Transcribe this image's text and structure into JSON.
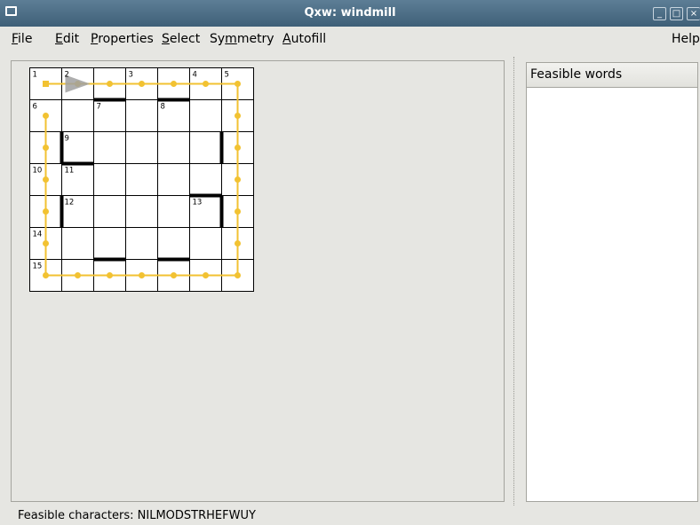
{
  "window": {
    "title": "Qxw: windmill",
    "controls": [
      "_",
      "□",
      "×"
    ]
  },
  "menu": {
    "items": [
      "File",
      "Edit",
      "Properties",
      "Select",
      "Symmetry",
      "Autofill"
    ],
    "help": "Help"
  },
  "grid": {
    "rows": 7,
    "cols": 7,
    "numbers": [
      {
        "r": 0,
        "c": 0,
        "n": "1"
      },
      {
        "r": 0,
        "c": 1,
        "n": "2"
      },
      {
        "r": 0,
        "c": 3,
        "n": "3"
      },
      {
        "r": 0,
        "c": 5,
        "n": "4"
      },
      {
        "r": 0,
        "c": 6,
        "n": "5"
      },
      {
        "r": 1,
        "c": 0,
        "n": "6"
      },
      {
        "r": 1,
        "c": 2,
        "n": "7"
      },
      {
        "r": 1,
        "c": 4,
        "n": "8"
      },
      {
        "r": 2,
        "c": 1,
        "n": "9"
      },
      {
        "r": 3,
        "c": 0,
        "n": "10"
      },
      {
        "r": 3,
        "c": 1,
        "n": "11"
      },
      {
        "r": 4,
        "c": 1,
        "n": "12"
      },
      {
        "r": 4,
        "c": 5,
        "n": "13"
      },
      {
        "r": 5,
        "c": 0,
        "n": "14"
      },
      {
        "r": 6,
        "c": 0,
        "n": "15"
      }
    ],
    "bars_h": [
      {
        "r": 1,
        "c": 2
      },
      {
        "r": 1,
        "c": 4
      },
      {
        "r": 3,
        "c": 1
      },
      {
        "r": 4,
        "c": 5
      },
      {
        "r": 6,
        "c": 2
      },
      {
        "r": 6,
        "c": 4
      }
    ],
    "bars_v": [
      {
        "r": 2,
        "c": 1
      },
      {
        "r": 2,
        "c": 6
      },
      {
        "r": 4,
        "c": 1
      },
      {
        "r": 4,
        "c": 6
      }
    ],
    "cursor": {
      "r": 0,
      "c": 1,
      "dir": "across"
    },
    "path_color": "#f2c232",
    "bar_color": "#000000"
  },
  "panel": {
    "header": "Feasible words"
  },
  "status": {
    "text": "Feasible characters: NILMODSTRHEFWUY"
  }
}
